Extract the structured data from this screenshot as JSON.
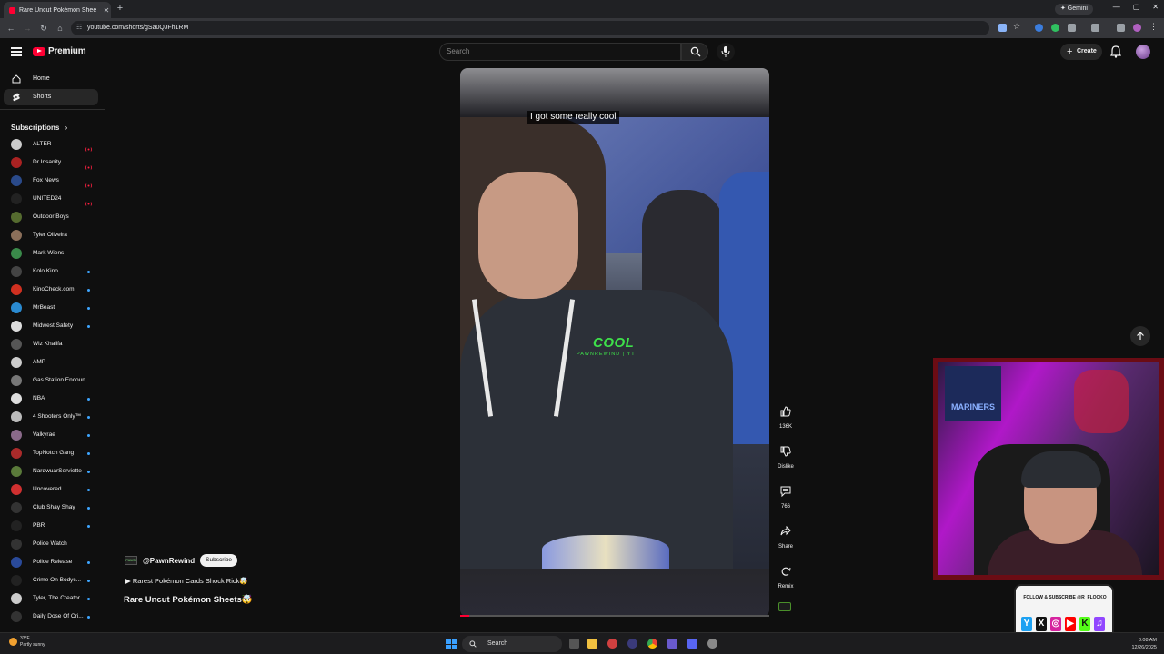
{
  "browser": {
    "tab_title": "Rare Uncut Pokémon Shee",
    "tab_close": "✕",
    "new_tab": "+",
    "gemini": "✦ Gemini",
    "url": "youtube.com/shorts/gSa0QJFh1RM",
    "window_controls": [
      "—",
      "▢",
      "✕"
    ]
  },
  "header": {
    "brand": "Premium",
    "search_placeholder": "Search",
    "create_label": "Create"
  },
  "sidebar": {
    "main": [
      {
        "label": "Home",
        "icon": "home-icon"
      },
      {
        "label": "Shorts",
        "icon": "shorts-icon",
        "active": true
      }
    ],
    "subscriptions_label": "Subscriptions",
    "subscriptions": [
      {
        "name": "ALTER",
        "status": "live",
        "color": "#cccccc"
      },
      {
        "name": "Dr Insanity",
        "status": "live",
        "color": "#aa2222"
      },
      {
        "name": "Fox News",
        "status": "live",
        "color": "#2a4a8a"
      },
      {
        "name": "UNITED24",
        "status": "live",
        "color": "#222222"
      },
      {
        "name": "Outdoor Boys",
        "status": "",
        "color": "#556b2f"
      },
      {
        "name": "Tyler Oliveira",
        "status": "",
        "color": "#8b6f5a"
      },
      {
        "name": "Mark Wiens",
        "status": "",
        "color": "#3a8a4a"
      },
      {
        "name": "Kolo Kino",
        "status": "new",
        "color": "#444444"
      },
      {
        "name": "KinoCheck.com",
        "status": "new",
        "color": "#d03020"
      },
      {
        "name": "MrBeast",
        "status": "new",
        "color": "#2a8ad0"
      },
      {
        "name": "Midwest Safety",
        "status": "new",
        "color": "#dddddd"
      },
      {
        "name": "Wiz Khalifa",
        "status": "",
        "color": "#555555"
      },
      {
        "name": "AMP",
        "status": "",
        "color": "#cccccc"
      },
      {
        "name": "Gas Station Encoun...",
        "status": "",
        "color": "#777777"
      },
      {
        "name": "NBA",
        "status": "new",
        "color": "#dddddd"
      },
      {
        "name": "4 Shooters Only™",
        "status": "new",
        "color": "#bbbbbb"
      },
      {
        "name": "Valkyrae",
        "status": "new",
        "color": "#8a6a8a"
      },
      {
        "name": "TopNotch Gang",
        "status": "new",
        "color": "#aa2a2a"
      },
      {
        "name": "NardwuarServiette",
        "status": "new",
        "color": "#5a7a3a"
      },
      {
        "name": "Uncovered",
        "status": "new",
        "color": "#d03030"
      },
      {
        "name": "Club Shay Shay",
        "status": "new",
        "color": "#333333"
      },
      {
        "name": "PBR",
        "status": "new",
        "color": "#222222"
      },
      {
        "name": "Police Watch",
        "status": "",
        "color": "#333333"
      },
      {
        "name": "Police Release",
        "status": "new",
        "color": "#2a4a9a"
      },
      {
        "name": "Crime On Bodyc...",
        "status": "new",
        "color": "#222222"
      },
      {
        "name": "Tyler, The Creator",
        "status": "new",
        "color": "#cccccc"
      },
      {
        "name": "Daily Dose Of Cri...",
        "status": "new",
        "color": "#333333"
      }
    ]
  },
  "video": {
    "caption": "I got some really cool",
    "overlay_word": "COOL",
    "watermark": "PAWNREWIND | YT",
    "progress": 0.03
  },
  "actions": [
    {
      "label": "136K",
      "icon": "like-icon"
    },
    {
      "label": "Dislike",
      "icon": "dislike-icon"
    },
    {
      "label": "766",
      "icon": "comment-icon"
    },
    {
      "label": "Share",
      "icon": "share-icon"
    },
    {
      "label": "Remix",
      "icon": "remix-icon"
    }
  ],
  "channel": {
    "mini_avatar": "PAWN",
    "handle": "@PawnRewind",
    "subscribe_label": "Subscribe",
    "playlist": "▶ Rarest Pokémon Cards Shock Rick🤯",
    "title": "Rare Uncut Pokémon Sheets🤯"
  },
  "overlay": {
    "banner_text": "MARINERS",
    "follow_text": "FOLLOW & SUBSCRIBE @R_FLOCKO",
    "social_icons": [
      "Y",
      "X",
      "◎",
      "▶",
      "K",
      "♫"
    ]
  },
  "taskbar": {
    "weather_temp": "33°F",
    "weather_desc": "Partly sunny",
    "search_label": "Search",
    "time": "8:08 AM",
    "date": "12/26/2025"
  },
  "colors": {
    "accent_red": "#ff0033",
    "kick_green": "#53fc18",
    "overlay_border": "#6b0c14"
  }
}
